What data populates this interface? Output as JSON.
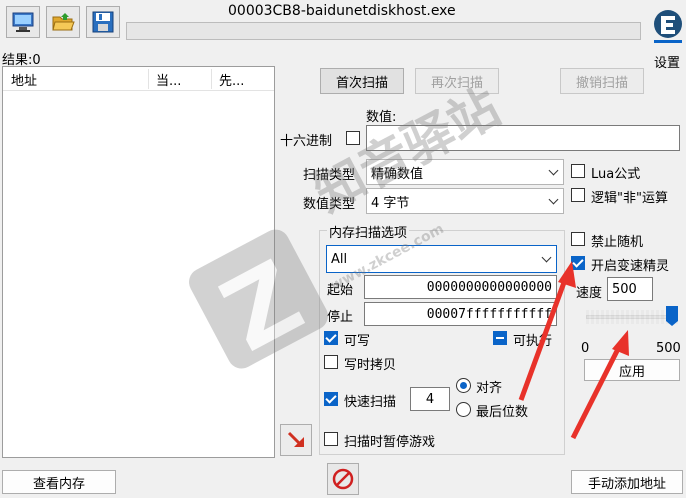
{
  "window_title": "00003CB8-baidunetdiskhost.exe",
  "settings_label": "设置",
  "results_label": "结果:0",
  "columns": [
    "地址",
    "当...",
    "先..."
  ],
  "buttons": {
    "first_scan": "首次扫描",
    "next_scan": "再次扫描",
    "undo_scan": "撤销扫描",
    "view_memory": "查看内存",
    "add_address": "手动添加地址",
    "apply": "应用"
  },
  "value_label": "数值:",
  "value_input": "",
  "hex_label": "十六进制",
  "scan_type_label": "扫描类型",
  "scan_type_value": "精确数值",
  "value_type_label": "数值类型",
  "value_type_value": "4 字节",
  "lua_label": "Lua公式",
  "logic_not_label": "逻辑\"非\"运算",
  "mem_options_title": "内存扫描选项",
  "mem_region_value": "All",
  "start_label": "起始",
  "start_value": "0000000000000000",
  "stop_label": "停止",
  "stop_value": "00007fffffffffff",
  "writable_label": "可写",
  "executable_label": "可执行",
  "copy_on_write_label": "写时拷贝",
  "fast_scan_label": "快速扫描",
  "fast_scan_value": "4",
  "align_label": "对齐",
  "last_digits_label": "最后位数",
  "pause_game_label": "扫描时暂停游戏",
  "disable_random_label": "禁止随机",
  "speedhack_label": "开启变速精灵",
  "speed_label": "速度",
  "speed_value": "500",
  "slider_min": "0",
  "slider_max": "500",
  "slider_level_fraction": 1.0,
  "watermark_text": "知音驿站",
  "watermark_url": "www.zkcee.com",
  "colors": {
    "accent": "#0a64c8",
    "arrow": "#e8322a"
  }
}
